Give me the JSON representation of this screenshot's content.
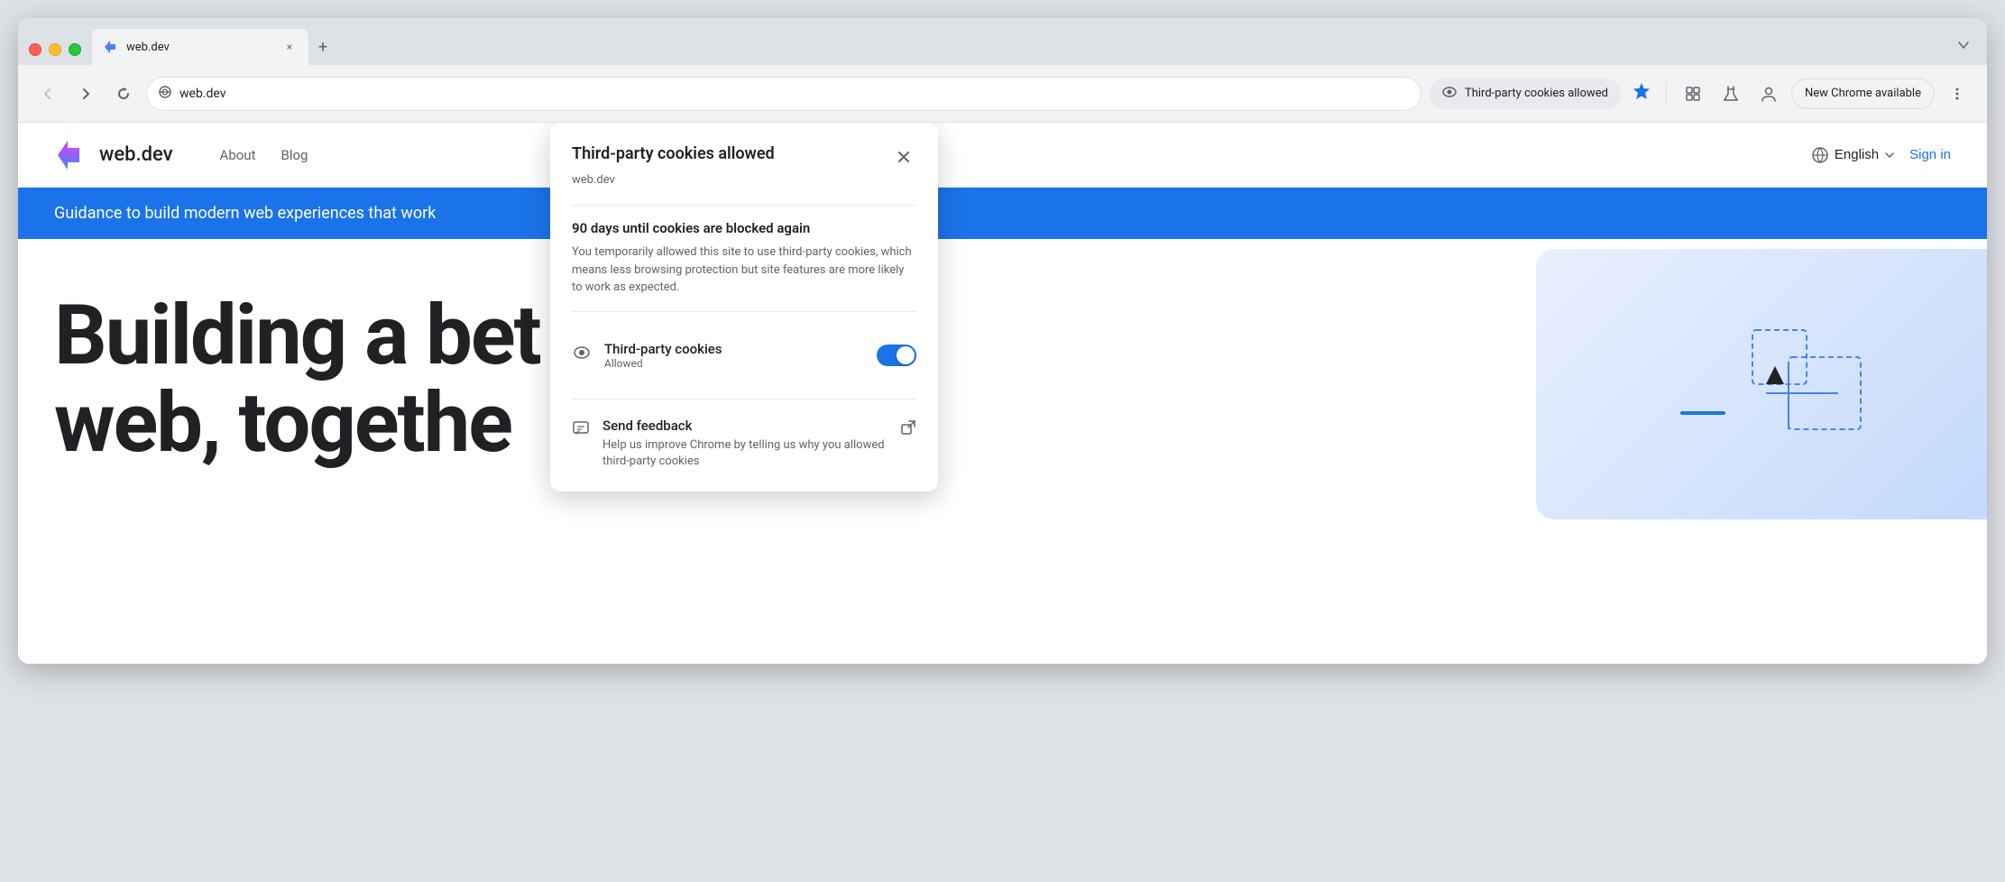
{
  "browser": {
    "tab": {
      "favicon_label": "web.dev favicon",
      "title": "web.dev",
      "close_label": "×",
      "new_tab_label": "+"
    },
    "toolbar": {
      "back_label": "←",
      "forward_label": "→",
      "reload_label": "↻",
      "address_icon_label": "⇄",
      "address_url": "web.dev",
      "cookies_badge_label": "Third-party cookies allowed",
      "star_label": "★",
      "extensions_label": "⊡",
      "labs_label": "⚗",
      "profile_label": "👤",
      "new_chrome_label": "New Chrome available",
      "more_label": "⋮",
      "tab_dropdown_label": "⌄"
    }
  },
  "site": {
    "logo_text": "web.dev",
    "nav_links": [
      "About",
      "Blog"
    ],
    "lang_button": "English",
    "lang_icon": "🌐",
    "lang_dropdown": "▾",
    "sign_in": "Sign in",
    "hero_banner": "Guidance to build modern web experiences that work",
    "hero_heading_line1": "Building a bet",
    "hero_heading_line2": "web, togethe"
  },
  "cookies_popup": {
    "title": "Third-party cookies allowed",
    "domain": "web.dev",
    "close_label": "×",
    "warning_title": "90 days until cookies are blocked again",
    "warning_text": "You temporarily allowed this site to use third-party cookies, which means less browsing protection but site features are more likely to work as expected.",
    "toggle_section": {
      "label": "Third-party cookies",
      "sublabel": "Allowed",
      "toggle_state": "on"
    },
    "feedback_section": {
      "title": "Send feedback",
      "text": "Help us improve Chrome by telling us why you allowed third-party cookies",
      "external_icon": "⧉"
    }
  }
}
